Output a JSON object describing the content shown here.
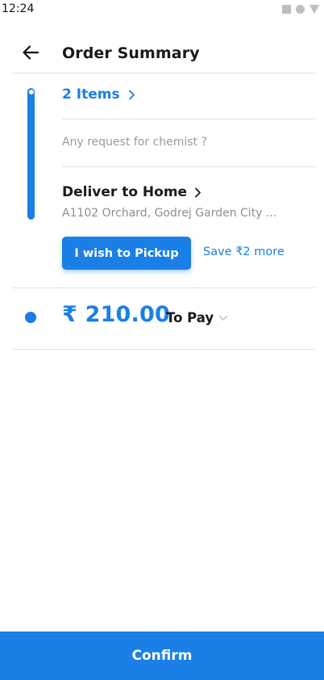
{
  "status_bar": {
    "time": "12:24",
    "icons": [
      "square-icon",
      "circle-icon",
      "triangle-icon"
    ]
  },
  "header": {
    "back_icon": "arrow-left-icon",
    "title": "Order Summary"
  },
  "order": {
    "items_label": "2 Items",
    "items_icon": "chevron-right-icon",
    "chemist_request_placeholder": "Any request for chemist ?",
    "chemist_request_value": "",
    "delivery_label": "Deliver to Home",
    "delivery_icon": "chevron-right-icon",
    "address": "A1102 Orchard, Godrej Garden City ...",
    "pickup_button_label": "I wish to Pickup",
    "pickup_savings": "Save ₹2 more"
  },
  "payment": {
    "amount": "₹ 210.00",
    "label": "To Pay",
    "dropdown_icon": "chevron-down-icon"
  },
  "footer": {
    "confirm_label": "Confirm"
  },
  "colors": {
    "accent": "#1a7fe6",
    "text_primary": "#1a1a1a",
    "text_muted": "#8e8e8e",
    "divider": "#e2e2e2"
  }
}
